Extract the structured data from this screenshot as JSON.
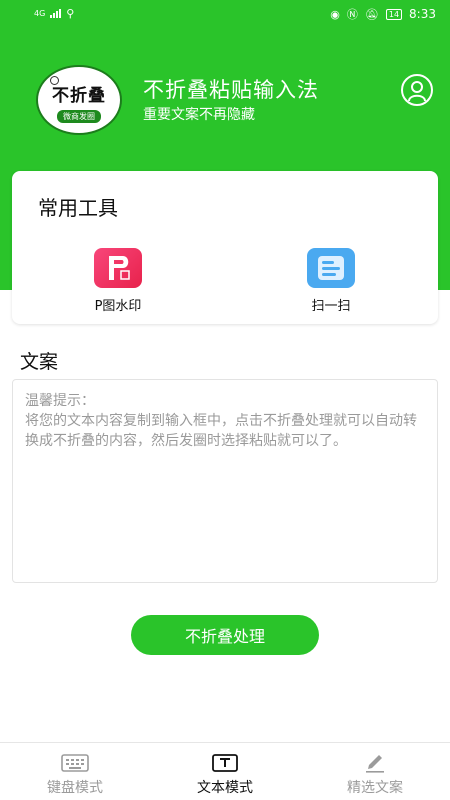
{
  "colors": {
    "brand_green": "#2ac42a",
    "watermark_icon": "#e8224c",
    "scan_icon": "#4aa9f0",
    "inactive_nav": "#9b9b9b"
  },
  "status_bar": {
    "network": "4G",
    "battery": "14",
    "time": "8:33"
  },
  "header": {
    "logo_text": "不折叠",
    "logo_sub": "微商发圈",
    "title": "不折叠粘贴输入法",
    "subtitle": "重要文案不再隐藏",
    "user_icon": "user-circle-icon"
  },
  "tools": {
    "title": "常用工具",
    "items": [
      {
        "label": "P图水印",
        "icon": "watermark-p-icon"
      },
      {
        "label": "扫一扫",
        "icon": "scan-icon"
      }
    ]
  },
  "copy": {
    "title": "文案",
    "placeholder": "温馨提示：\n将您的文本内容复制到输入框中，点击不折叠处理就可以自动转换成不折叠的内容，然后发圈时选择粘贴就可以了。"
  },
  "process_button": "不折叠处理",
  "bottom_nav": [
    {
      "label": "键盘模式",
      "icon": "keyboard-icon",
      "active": false
    },
    {
      "label": "文本模式",
      "icon": "text-icon",
      "active": true
    },
    {
      "label": "精选文案",
      "icon": "pen-icon",
      "active": false
    }
  ]
}
